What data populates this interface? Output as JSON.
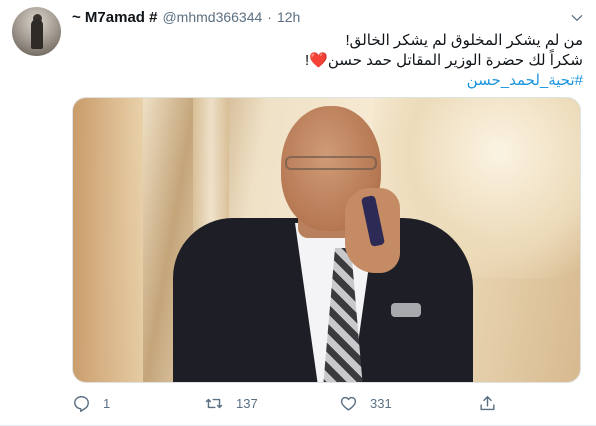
{
  "tweet": {
    "display_name": "~ M7amad #",
    "handle": "@mhmd366344",
    "separator": "·",
    "time": "12h",
    "lines": [
      "من لم يشكر المخلوق لم يشكر الخالق!",
      "شكراً لك حضرة الوزير المقاتل حمد حسن",
      "#تحية_لحمد_حسن"
    ],
    "heart_emoji": "❤️",
    "line2_suffix": "!",
    "photo_alt": "photo"
  },
  "actions": {
    "reply_count": "1",
    "retweet_count": "137",
    "like_count": "331"
  },
  "colors": {
    "accent": "#1b95e0",
    "secondary_text": "#5b7083",
    "heart": "#e0245e"
  },
  "icons": [
    "chevron-down-icon",
    "reply-icon",
    "retweet-icon",
    "like-icon",
    "share-icon"
  ]
}
